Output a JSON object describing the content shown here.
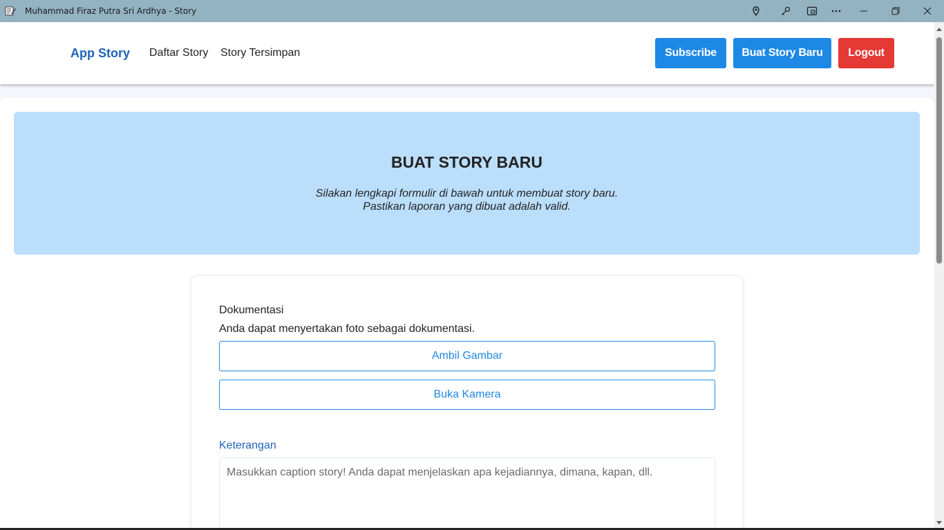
{
  "window": {
    "title": "Muhammad Firaz Putra Sri Ardhya - Story",
    "icons": [
      "app-notepad-icon",
      "location-icon",
      "key-icon",
      "cast-icon",
      "more-icon",
      "minimize-icon",
      "restore-icon",
      "close-icon"
    ]
  },
  "header": {
    "brand": "App Story",
    "nav": [
      "Daftar Story",
      "Story Tersimpan"
    ],
    "subscribe_label": "Subscribe",
    "new_story_label": "Buat Story Baru",
    "logout_label": "Logout"
  },
  "hero": {
    "title": "BUAT STORY BARU",
    "line1": "Silakan lengkapi formulir di bawah untuk membuat story baru.",
    "line2": "Pastikan laporan yang dibuat adalah valid."
  },
  "form": {
    "doc_label": "Dokumentasi",
    "doc_hint": "Anda dapat menyertakan foto sebagai dokumentasi.",
    "take_picture_label": "Ambil Gambar",
    "open_camera_label": "Buka Kamera",
    "caption_label": "Keterangan",
    "caption_placeholder": "Masukkan caption story! Anda dapat menjelaskan apa kejadiannya, dimana, kapan, dll.",
    "caption_value": ""
  },
  "colors": {
    "primary": "#1e88e5",
    "danger": "#e53935",
    "brand": "#1e63b8",
    "hero_bg": "#bbdefb",
    "titlebar_bg": "#93b3c3"
  }
}
